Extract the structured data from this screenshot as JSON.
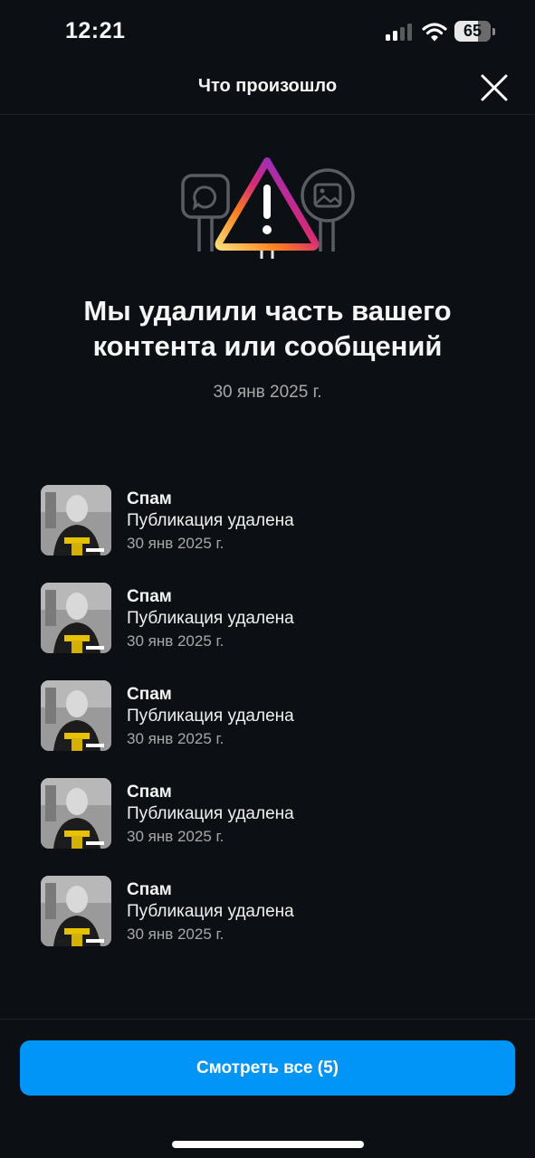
{
  "status_bar": {
    "time": "12:21",
    "battery": "65",
    "battery_level": 0.65
  },
  "header": {
    "title": "Что произошло",
    "close_icon": "close-icon"
  },
  "illustration": {
    "icon": "warning-triangle-icon",
    "left_sign_icon": "chat-bubble-icon",
    "right_sign_icon": "image-icon"
  },
  "headline": {
    "title": "Мы удалили часть вашего контента или сообщений",
    "date": "30 янв 2025 г."
  },
  "items": [
    {
      "title": "Спам",
      "subtitle": "Публикация удалена",
      "date": "30 янв 2025 г."
    },
    {
      "title": "Спам",
      "subtitle": "Публикация удалена",
      "date": "30 янв 2025 г."
    },
    {
      "title": "Спам",
      "subtitle": "Публикация удалена",
      "date": "30 янв 2025 г."
    },
    {
      "title": "Спам",
      "subtitle": "Публикация удалена",
      "date": "30 янв 2025 г."
    },
    {
      "title": "Спам",
      "subtitle": "Публикация удалена",
      "date": "30 янв 2025 г."
    }
  ],
  "footer": {
    "button_label": "Смотреть все (5)"
  },
  "colors": {
    "background": "#0c1014",
    "accent": "#0095f6",
    "muted_text": "#a8a8a8"
  }
}
